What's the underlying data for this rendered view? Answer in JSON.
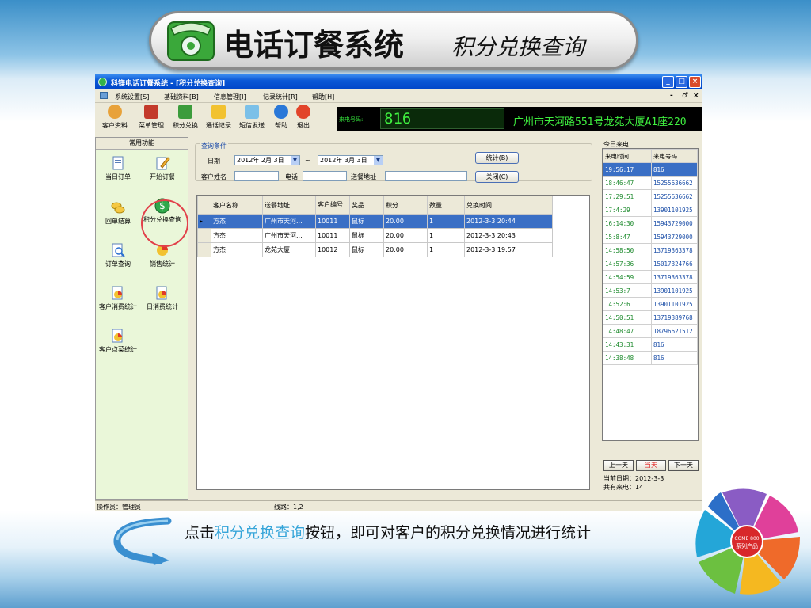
{
  "banner": {
    "title": "电话订餐系统",
    "subtitle": "积分兑换查询"
  },
  "window": {
    "title": "科镁电话订餐系统 - [积分兑换查询]",
    "controls": [
      "_",
      "□",
      "×"
    ],
    "mdi_controls": [
      "-",
      "♂",
      "×"
    ]
  },
  "menu": [
    "系统设置[S]",
    "基础资料[B]",
    "信息管理[I]",
    "记录统计[R]",
    "帮助[H]"
  ],
  "toolbar": [
    {
      "label": "客户资料",
      "icon": "users-icon",
      "color": "#e8a23a"
    },
    {
      "label": "菜单管理",
      "icon": "book-icon",
      "color": "#c33a2b"
    },
    {
      "label": "积分兑换",
      "icon": "gift-icon",
      "color": "#3c9c3c"
    },
    {
      "label": "通话记录",
      "icon": "notes-icon",
      "color": "#f2c230"
    },
    {
      "label": "短信发送",
      "icon": "sms-icon",
      "color": "#7bc0e8"
    },
    {
      "label": "帮助",
      "icon": "help-icon",
      "color": "#2a78d8"
    },
    {
      "label": "退出",
      "icon": "exit-icon",
      "color": "#e2442a"
    }
  ],
  "caller": {
    "label": "来电号码:",
    "number": "816",
    "address": "广州市天河路551号龙苑大厦A1座220"
  },
  "left_panel": {
    "header": "常用功能",
    "items": [
      {
        "label": "当日订单",
        "icon": "document-icon"
      },
      {
        "label": "开始订餐",
        "icon": "pencil-icon"
      },
      {
        "label": "回单结算",
        "icon": "coins-icon"
      },
      {
        "label": "积分兑换查询",
        "icon": "dollar-icon"
      },
      {
        "label": "订单查询",
        "icon": "search-doc-icon"
      },
      {
        "label": "销售统计",
        "icon": "pie-chart-icon"
      },
      {
        "label": "客户消费统计",
        "icon": "chart-doc-icon"
      },
      {
        "label": "日消费统计",
        "icon": "chart-doc-icon"
      },
      {
        "label": "客户点菜统计",
        "icon": "chart-doc-icon"
      }
    ]
  },
  "query": {
    "title": "查询条件",
    "date_label": "日期",
    "date_from": "2012年 2月 3日",
    "tilde": "~",
    "date_to": "2012年 3月 3日",
    "customer_label": "客户姓名",
    "customer_value": "",
    "phone_label": "电话",
    "phone_value": "",
    "address_label": "送餐地址",
    "address_value": "",
    "stat_button": "统计(B)",
    "close_button": "关闭(C)"
  },
  "table": {
    "columns": [
      "客户名称",
      "送餐地址",
      "客户编号",
      "奖品",
      "积分",
      "数量",
      "兑换时间"
    ],
    "rows": [
      [
        "方杰",
        "广州市天河...",
        "10011",
        "鼠标",
        "20.00",
        "1",
        "2012-3-3 20:44"
      ],
      [
        "方杰",
        "广州市天河...",
        "10011",
        "鼠标",
        "20.00",
        "1",
        "2012-3-3 20:43"
      ],
      [
        "方杰",
        "龙苑大厦",
        "10012",
        "鼠标",
        "20.00",
        "1",
        "2012-3-3 19:57"
      ]
    ],
    "selected_row": 0
  },
  "right_panel": {
    "title": "今日来电",
    "columns": [
      "来电时间",
      "来电号码"
    ],
    "calls": [
      [
        "19:56:17",
        "816"
      ],
      [
        "18:46:47",
        "15255636662"
      ],
      [
        "17:29:51",
        "15255636662"
      ],
      [
        "17:4:29",
        "13901101925"
      ],
      [
        "16:14:30",
        "15943729000"
      ],
      [
        "15:8:47",
        "15943729000"
      ],
      [
        "14:58:50",
        "13719363378"
      ],
      [
        "14:57:36",
        "15017324766"
      ],
      [
        "14:54:59",
        "13719363378"
      ],
      [
        "14:53:7",
        "13901101925"
      ],
      [
        "14:52:6",
        "13901101925"
      ],
      [
        "14:50:51",
        "13719389768"
      ],
      [
        "14:48:47",
        "18796621512"
      ],
      [
        "14:43:31",
        "816"
      ],
      [
        "14:38:48",
        "816"
      ]
    ],
    "prev_button": "上一天",
    "today_button": "当天",
    "next_button": "下一天",
    "current_date": "当前日期：2012-3-3",
    "total_calls": "共有来电：14"
  },
  "status": {
    "operator": "操作员：管理员",
    "lines": "线路：1,2"
  },
  "caption": {
    "prefix": "点击",
    "highlight": "积分兑换查询",
    "suffix": "按钮，即可对客户的积分兑换情况进行统计"
  },
  "logo": {
    "center_text": "COME 800",
    "center_sub": "系列产品"
  }
}
